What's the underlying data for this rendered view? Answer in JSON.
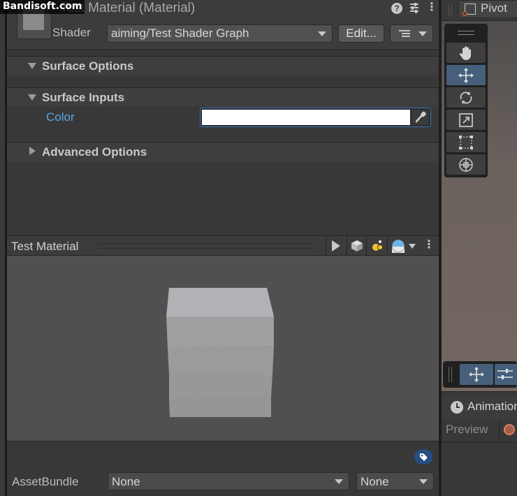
{
  "watermark": "Bandisoft.com",
  "inspector": {
    "title": "Test Material (Material)",
    "shader_label": "Shader",
    "shader_value": "aiming/Test Shader Graph",
    "edit_label": "Edit...",
    "sections": {
      "surface_options": "Surface Options",
      "surface_inputs": "Surface Inputs",
      "advanced_options": "Advanced Options"
    },
    "color_label": "Color",
    "color_value": "#ffffff"
  },
  "preview": {
    "title": "Test Material"
  },
  "asset_bundle": {
    "label": "AssetBundle",
    "bundle_value": "None",
    "variant_value": "None"
  },
  "scene": {
    "pivot_label": "Pivot"
  },
  "animation": {
    "tab_label": "Animation",
    "preview_label": "Preview"
  },
  "colors": {
    "accent_blue": "#46607c",
    "link_blue": "#58a6e8",
    "record": "#d28566"
  }
}
